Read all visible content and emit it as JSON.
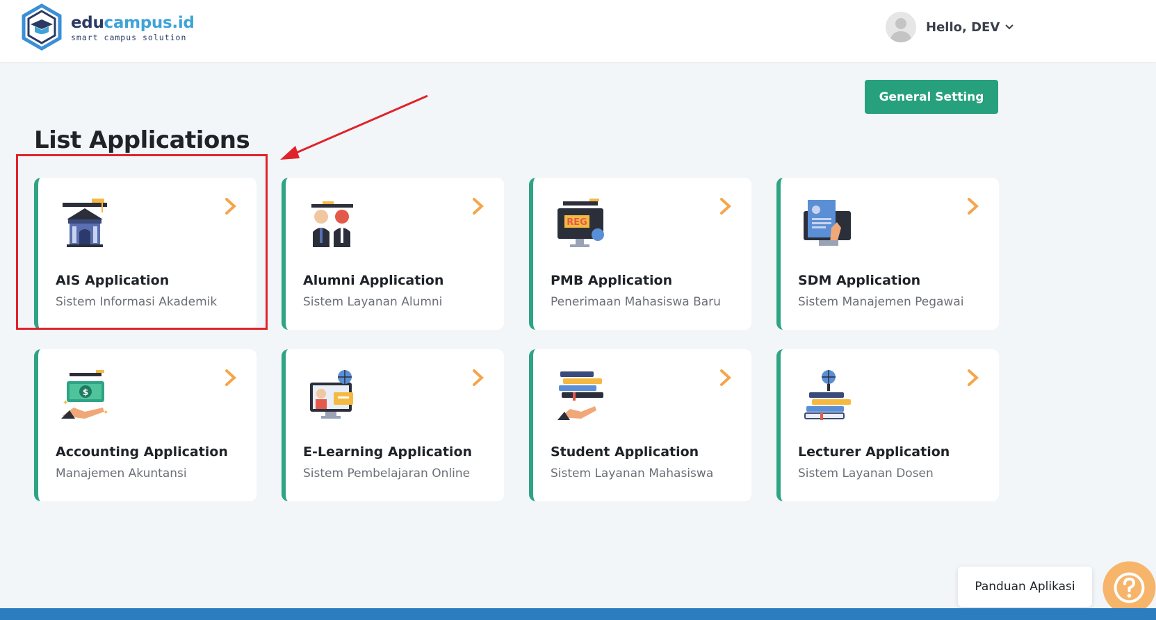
{
  "header": {
    "brand_part1": "edu",
    "brand_part2": "campus.id",
    "tagline": "smart campus solution",
    "greeting": "Hello, DEV"
  },
  "toolbar": {
    "general_setting_label": "General Setting"
  },
  "page": {
    "title": "List Applications"
  },
  "apps": [
    {
      "title": "AIS Application",
      "subtitle": "Sistem Informasi Akademik",
      "icon": "academic-building-icon"
    },
    {
      "title": "Alumni Application",
      "subtitle": "Sistem Layanan Alumni",
      "icon": "graduates-icon"
    },
    {
      "title": "PMB Application",
      "subtitle": "Penerimaan Mahasiswa Baru",
      "icon": "registration-monitor-icon"
    },
    {
      "title": "SDM Application",
      "subtitle": "Sistem Manajemen Pegawai",
      "icon": "employee-document-icon"
    },
    {
      "title": "Accounting Application",
      "subtitle": "Manajemen Akuntansi",
      "icon": "money-hand-icon"
    },
    {
      "title": "E-Learning Application",
      "subtitle": "Sistem Pembelajaran Online",
      "icon": "online-learning-icon"
    },
    {
      "title": "Student Application",
      "subtitle": "Sistem Layanan Mahasiswa",
      "icon": "books-hand-icon"
    },
    {
      "title": "Lecturer Application",
      "subtitle": "Sistem Layanan Dosen",
      "icon": "books-globe-icon"
    }
  ],
  "help": {
    "label": "Panduan Aplikasi"
  },
  "colors": {
    "accent": "#26a07d",
    "card_border": "#2ea485",
    "arrow": "#f5a54a",
    "highlight": "#e0232b",
    "footer": "#2b7dc0"
  }
}
